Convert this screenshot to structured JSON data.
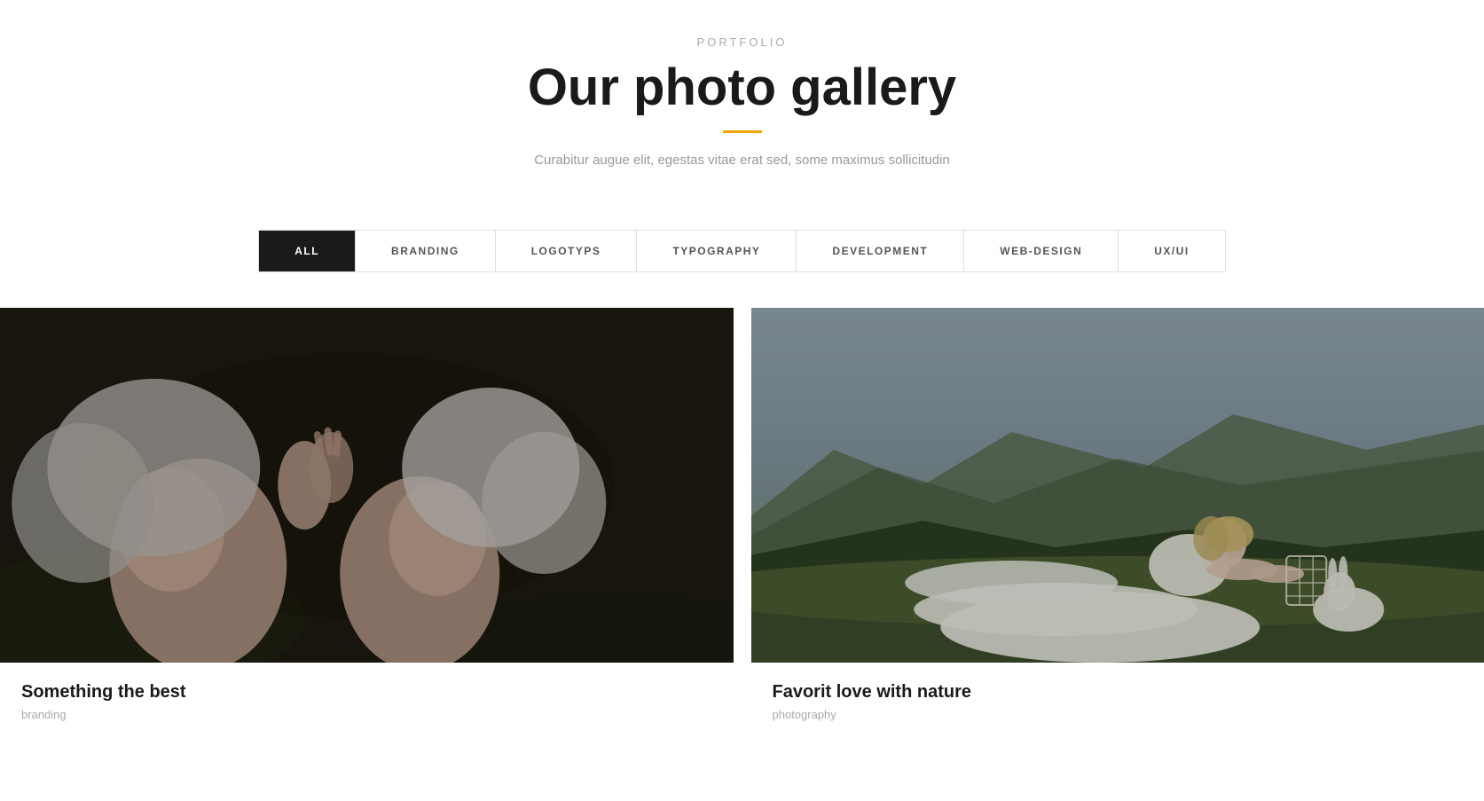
{
  "header": {
    "portfolio_label": "PORTFOLIO",
    "gallery_title": "Our photo gallery",
    "subtitle": "Curabitur augue elit, egestas vitae erat sed, some maximus sollicitudin",
    "divider_color": "#f0a500"
  },
  "filters": {
    "items": [
      {
        "id": "all",
        "label": "ALL",
        "active": true
      },
      {
        "id": "branding",
        "label": "BRANDING",
        "active": false
      },
      {
        "id": "logotyps",
        "label": "LOGOTYPS",
        "active": false
      },
      {
        "id": "typography",
        "label": "TYPOGRAPHY",
        "active": false
      },
      {
        "id": "development",
        "label": "DEVELOPMENT",
        "active": false
      },
      {
        "id": "web-design",
        "label": "WEB-DESIGN",
        "active": false
      },
      {
        "id": "ux-ui",
        "label": "UX/UI",
        "active": false
      }
    ]
  },
  "gallery": {
    "items": [
      {
        "id": "item-1",
        "title": "Something the best",
        "category": "branding",
        "image_alt": "Two women with white hair lying in grass"
      },
      {
        "id": "item-2",
        "title": "Favorit love with nature",
        "category": "photography",
        "image_alt": "Woman in white wedding dress on green hillside with rabbit"
      }
    ]
  }
}
